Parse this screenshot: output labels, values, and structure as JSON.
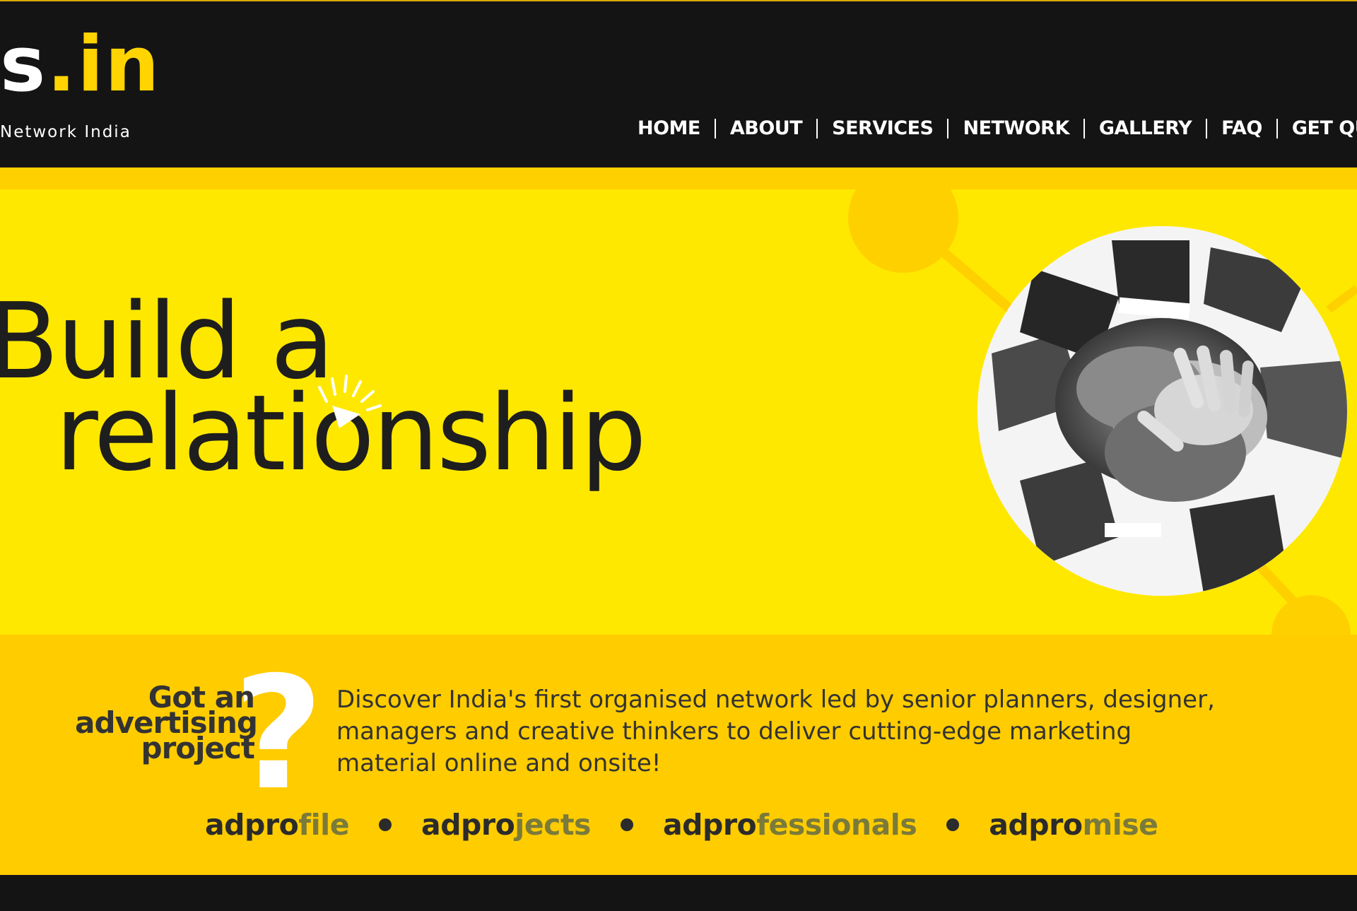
{
  "header": {
    "logo_main_prefix": "s",
    "logo_main_suffix": ".in",
    "logo_tagline": "Network India"
  },
  "nav": {
    "items": [
      "HOME",
      "ABOUT",
      "SERVICES",
      "NETWORK",
      "GALLERY",
      "FAQ",
      "GET QUOTE"
    ]
  },
  "hero": {
    "headline_line1": "Build a",
    "headline_line2": "relationship",
    "image_icon": "team-hands-photo"
  },
  "band": {
    "question_lines": [
      "Got an",
      "advertising",
      "project"
    ],
    "question_mark": "?",
    "description": "Discover India's first organised network led by senior planners, designer, managers and creative thinkers to deliver cutting-edge marketing material online and onsite!",
    "pillars": [
      {
        "prefix": "adpro",
        "suffix": "file"
      },
      {
        "prefix": "adpro",
        "suffix": "jects"
      },
      {
        "prefix": "adpro",
        "suffix": "fessionals"
      },
      {
        "prefix": "adpro",
        "suffix": "mise"
      }
    ]
  },
  "colors": {
    "header_bg": "#141414",
    "accent_yellow": "#ffd400",
    "hero_bg": "#ffe800",
    "band_bg": "#ffcc00",
    "text_dark": "#1e1e1e"
  }
}
